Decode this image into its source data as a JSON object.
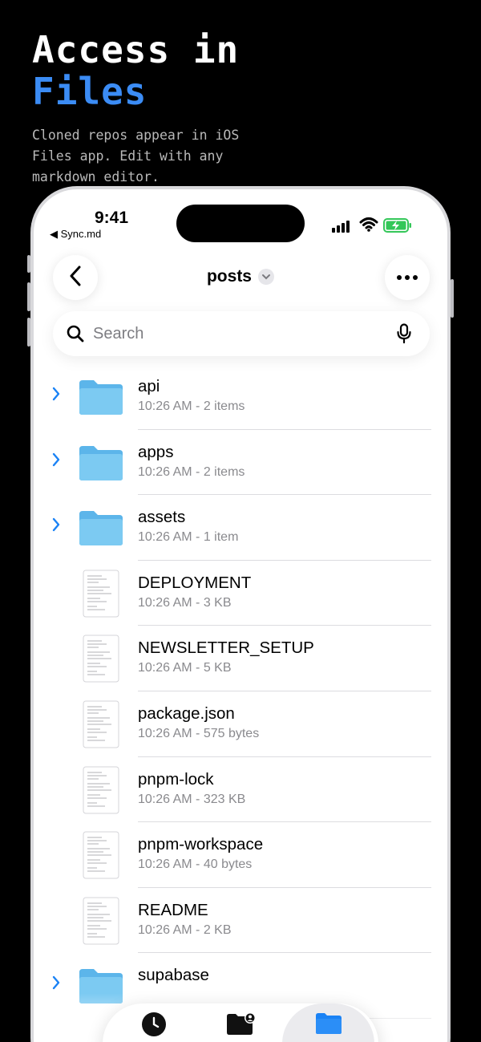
{
  "promo": {
    "title_line1": "Access in",
    "title_line2": "Files",
    "subtitle": "Cloned repos appear in iOS Files app. Edit with any markdown editor.",
    "accent_color": "#3b8cf5"
  },
  "status_bar": {
    "time": "9:41",
    "back_label": "◀ Sync.md"
  },
  "nav": {
    "title": "posts",
    "back_icon": "chevron-left-icon",
    "more_icon": "ellipsis-icon"
  },
  "search": {
    "placeholder": "Search"
  },
  "items": [
    {
      "name": "api",
      "meta": "10:26 AM - 2 items",
      "type": "folder"
    },
    {
      "name": "apps",
      "meta": "10:26 AM - 2 items",
      "type": "folder"
    },
    {
      "name": "assets",
      "meta": "10:26 AM - 1 item",
      "type": "folder"
    },
    {
      "name": "DEPLOYMENT",
      "meta": "10:26 AM - 3 KB",
      "type": "file"
    },
    {
      "name": "NEWSLETTER_SETUP",
      "meta": "10:26 AM - 5 KB",
      "type": "file"
    },
    {
      "name": "package.json",
      "meta": "10:26 AM - 575 bytes",
      "type": "file"
    },
    {
      "name": "pnpm-lock",
      "meta": "10:26 AM - 323 KB",
      "type": "file"
    },
    {
      "name": "pnpm-workspace",
      "meta": "10:26 AM - 40 bytes",
      "type": "file"
    },
    {
      "name": "README",
      "meta": "10:26 AM - 2 KB",
      "type": "file"
    },
    {
      "name": "supabase",
      "meta": "",
      "type": "folder"
    }
  ],
  "tabs": [
    {
      "name": "recents",
      "icon": "clock-icon"
    },
    {
      "name": "shared",
      "icon": "shared-folder-icon"
    },
    {
      "name": "browse",
      "icon": "folder-icon",
      "active": true
    }
  ]
}
